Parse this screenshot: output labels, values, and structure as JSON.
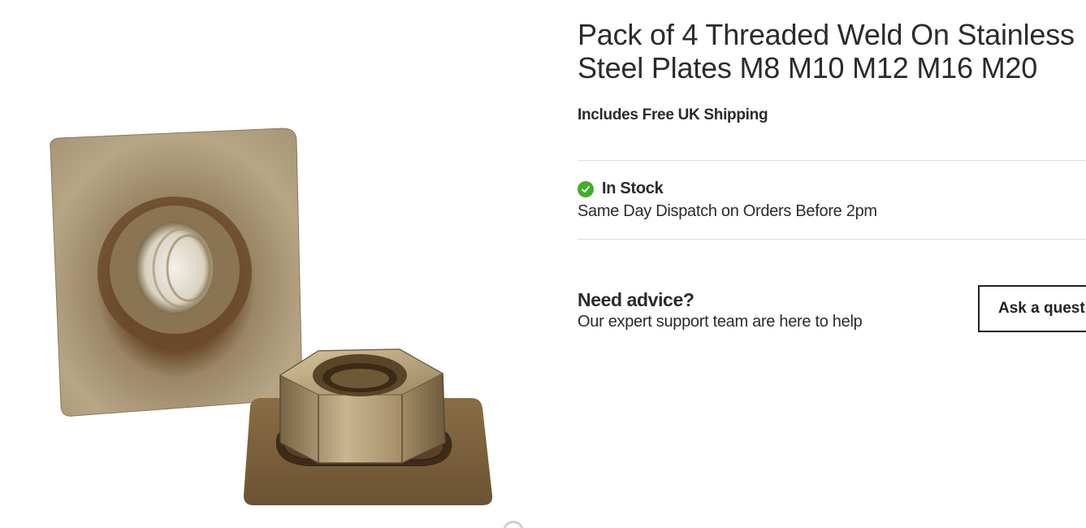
{
  "product": {
    "title": "Pack of 4 Threaded Weld On Stainless Steel Plates M8 M10 M12 M16 M20",
    "shipping_note": "Includes Free UK Shipping",
    "image_alt": "Threaded weld on stainless steel plate with hex nut"
  },
  "stock": {
    "status": "In Stock",
    "dispatch_note": "Same Day Dispatch on Orders Before 2pm",
    "icon": "check-circle-icon",
    "color": "#3fae2a"
  },
  "advice": {
    "title": "Need advice?",
    "subtitle": "Our expert support team are here to help",
    "button_label": "Ask a question"
  },
  "gallery": {
    "zoom_icon": "zoom-icon"
  }
}
